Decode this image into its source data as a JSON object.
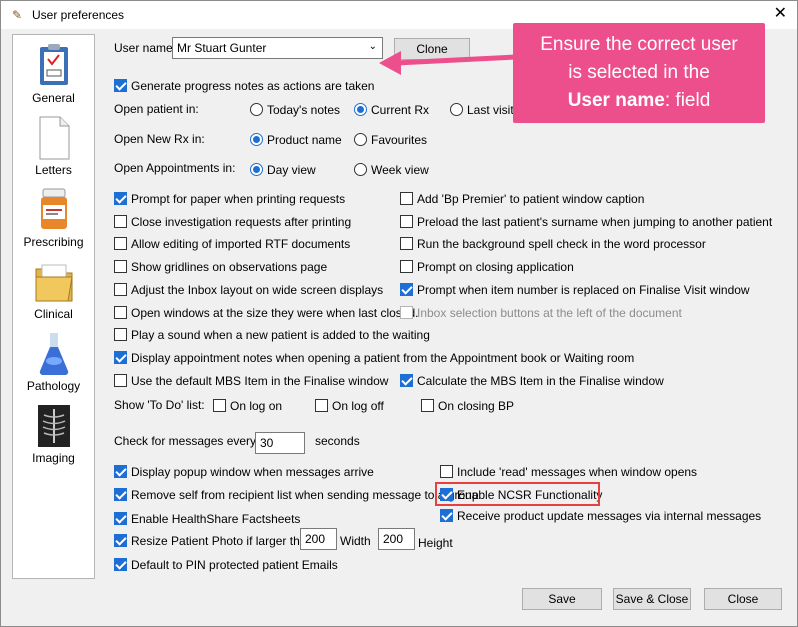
{
  "window": {
    "title": "User preferences"
  },
  "sidebar": {
    "items": [
      {
        "label": "General"
      },
      {
        "label": "Letters"
      },
      {
        "label": "Prescribing"
      },
      {
        "label": "Clinical"
      },
      {
        "label": "Pathology"
      },
      {
        "label": "Imaging"
      }
    ]
  },
  "user": {
    "label": "User name:",
    "value": "Mr Stuart Gunter",
    "clone_label": "Clone"
  },
  "progress_notes": {
    "label": "Generate progress notes as actions are taken",
    "checked": true
  },
  "open_patient": {
    "label": "Open patient in:",
    "options": [
      "Today's notes",
      "Current Rx",
      "Last visit"
    ],
    "selected": "Current Rx"
  },
  "open_rx": {
    "label": "Open New Rx in:",
    "options": [
      "Product name",
      "Favourites"
    ],
    "selected": "Product name"
  },
  "open_appt": {
    "label": "Open Appointments in:",
    "options": [
      "Day view",
      "Week view"
    ],
    "selected": "Day view"
  },
  "left_checks": [
    {
      "label": "Prompt for paper when printing requests",
      "checked": true
    },
    {
      "label": "Close investigation requests after printing",
      "checked": false
    },
    {
      "label": "Allow editing of imported RTF documents",
      "checked": false
    },
    {
      "label": "Show gridlines on observations page",
      "checked": false
    },
    {
      "label": "Adjust the Inbox layout on wide screen displays",
      "checked": false
    },
    {
      "label": "Open windows at the size they were when last closed.",
      "checked": false
    },
    {
      "label": "Play a sound when a new patient is added to the waiting",
      "checked": false
    },
    {
      "label": "Display appointment notes when opening a patient from the Appointment book or Waiting room",
      "checked": true
    },
    {
      "label": "Use the default MBS Item in the Finalise window",
      "checked": false
    }
  ],
  "right_checks": [
    {
      "label": "Add 'Bp Premier' to patient window caption",
      "checked": false
    },
    {
      "label": "Preload the last patient's surname when jumping to another patient",
      "checked": false
    },
    {
      "label": "Run the background spell check in the word processor",
      "checked": false
    },
    {
      "label": "Prompt on closing application",
      "checked": false
    },
    {
      "label": "Prompt when item number is replaced on Finalise Visit window",
      "checked": true
    },
    {
      "label": "Inbox selection buttons at the left of the document",
      "checked": false,
      "disabled": true
    },
    {
      "label": "Calculate the MBS Item in the Finalise window",
      "checked": true
    }
  ],
  "todo": {
    "label": "Show 'To Do' list:",
    "options": [
      "On log on",
      "On log off",
      "On closing BP"
    ]
  },
  "messages": {
    "label": "Check for messages every",
    "value": "30",
    "unit": "seconds"
  },
  "msg_left": [
    {
      "label": "Display popup window when messages arrive",
      "checked": true
    },
    {
      "label": "Remove self from recipient list when sending message to a group",
      "checked": true
    },
    {
      "label": "Enable HealthShare Factsheets",
      "checked": true
    }
  ],
  "msg_right": [
    {
      "label": "Include 'read' messages when window opens",
      "checked": false
    },
    {
      "label": "Enable NCSR Functionality",
      "checked": true
    },
    {
      "label": "Receive product update messages via internal messages",
      "checked": true
    }
  ],
  "photo": {
    "label": "Resize Patient Photo if larger than:",
    "checked": true,
    "width": "200",
    "width_label": "Width",
    "height": "200",
    "height_label": "Height"
  },
  "pin_emails": {
    "label": "Default to PIN protected patient Emails",
    "checked": true
  },
  "buttons": {
    "save": "Save",
    "save_close": "Save & Close",
    "close": "Close"
  },
  "callout": {
    "line1": "Ensure the correct user",
    "line2": "is selected in the",
    "bold": "User name",
    "rest": ": field"
  },
  "colors": {
    "accent": "#1e6fd4",
    "callout": "#ec4f8b",
    "highlight": "#e84040"
  }
}
